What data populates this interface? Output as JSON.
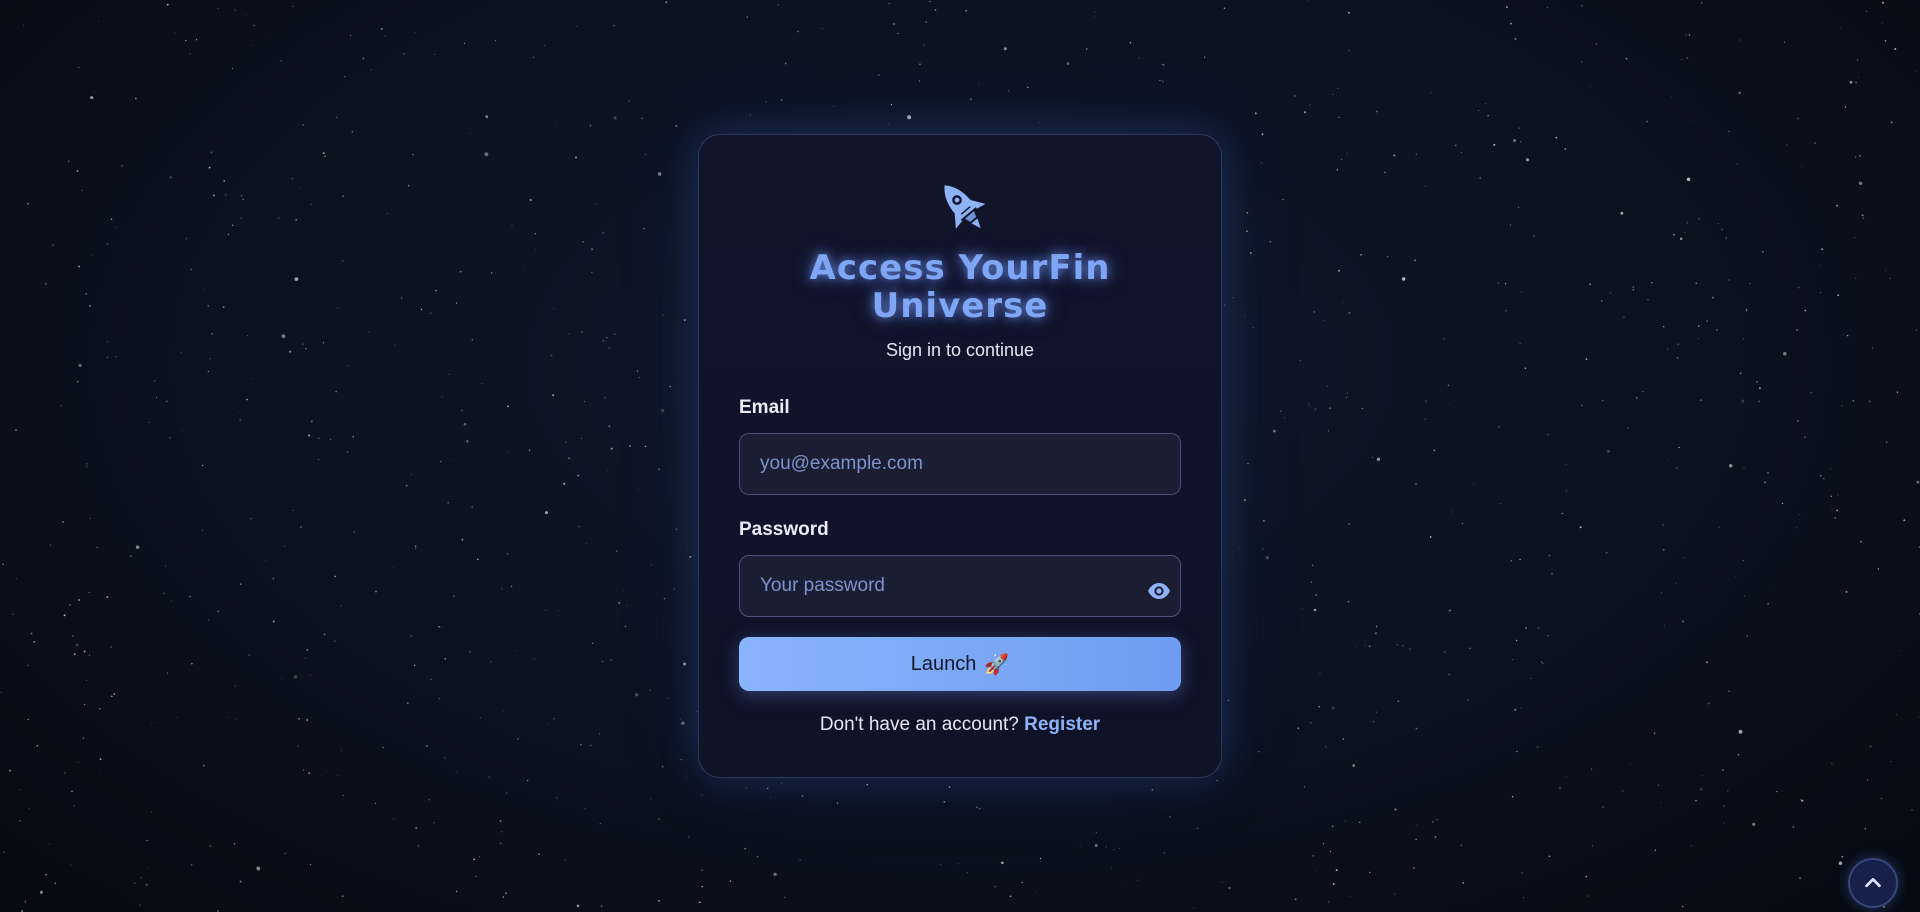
{
  "colors": {
    "accent": "#7fa5f5",
    "button": "#8ab4fb",
    "card_background": "#12142a",
    "page_background": "#0b1322",
    "link": "#8fb2f7"
  },
  "login": {
    "logo_icon": "rocket-icon",
    "title_line1": "Access YourFin",
    "title_line2": "Universe",
    "subtitle": "Sign in to continue",
    "email": {
      "label": "Email",
      "value": "",
      "placeholder": "you@example.com"
    },
    "password": {
      "label": "Password",
      "value": "",
      "placeholder": "Your password",
      "toggle_icon": "eye-icon"
    },
    "submit_label": "Launch",
    "submit_emoji": "🚀",
    "footer_prompt": "Don't have an account?",
    "register_label": "Register"
  },
  "scroll_top": {
    "icon": "chevron-up-icon"
  }
}
